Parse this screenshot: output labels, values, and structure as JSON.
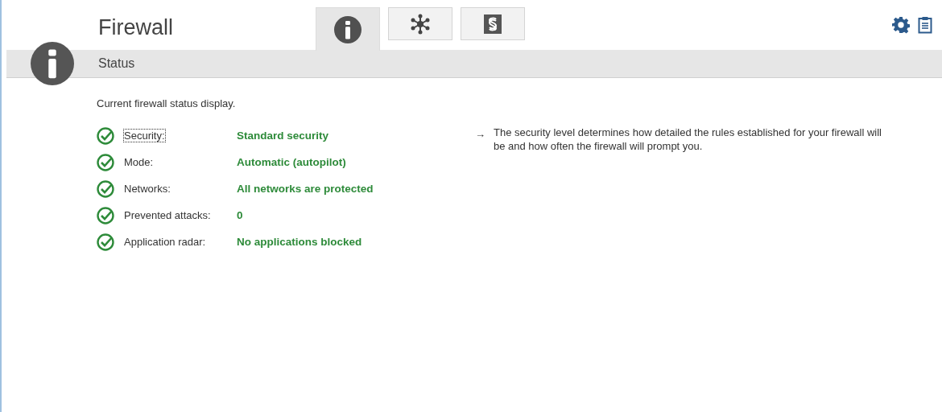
{
  "header": {
    "title": "Firewall"
  },
  "tabs": [
    {
      "kind": "info",
      "selected": true
    },
    {
      "kind": "network",
      "selected": false
    },
    {
      "kind": "rules",
      "selected": false
    }
  ],
  "section": {
    "title": "Status"
  },
  "description": "Current firewall status display.",
  "status_rows": [
    {
      "label": "Security:",
      "value": "Standard security",
      "ok": true,
      "focused": true
    },
    {
      "label": "Mode:",
      "value": "Automatic (autopilot)",
      "ok": true,
      "focused": false
    },
    {
      "label": "Networks:",
      "value": "All networks are protected",
      "ok": true,
      "focused": false
    },
    {
      "label": "Prevented attacks:",
      "value": "0",
      "ok": true,
      "focused": false
    },
    {
      "label": "Application radar:",
      "value": "No applications blocked",
      "ok": true,
      "focused": false
    }
  ],
  "hint": {
    "arrow": "→",
    "text": "The security level determines how detailed the rules established for your firewall will be and how often the firewall will prompt you."
  }
}
